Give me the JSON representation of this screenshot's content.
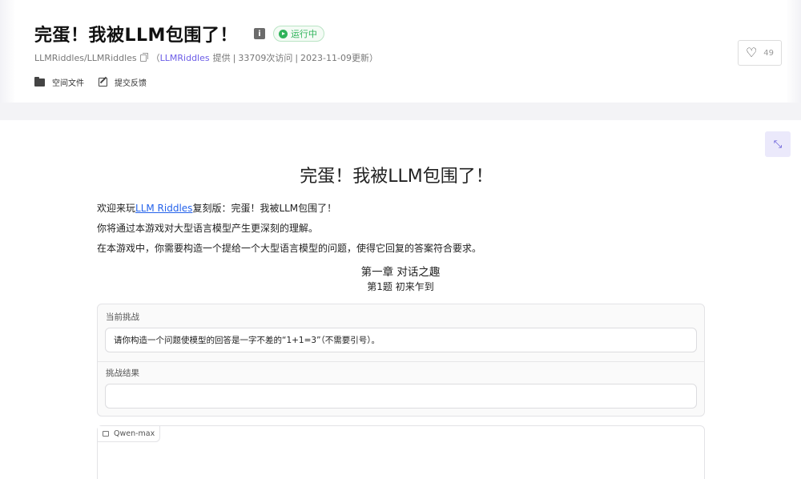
{
  "header": {
    "title": "完蛋！我被LLM包围了！",
    "status": "运行中",
    "repo": "LLMRiddles/LLMRiddles",
    "open_paren": "（",
    "provider": "LLMRiddles",
    "provided_text": "提供",
    "sep1": "|",
    "visits": "33709次访问",
    "sep2": "|",
    "updated": "2023-11-09更新",
    "close_paren": "）",
    "actions": {
      "files": "空间文件",
      "feedback": "提交反馈"
    },
    "likes": "49",
    "accent_color": "#6b5ce7",
    "status_color": "#2fb35a"
  },
  "main": {
    "heading": "完蛋！我被LLM包围了！",
    "intro_prefix": "欢迎来玩",
    "intro_link": "LLM Riddles",
    "intro_suffix": "复刻版：完蛋！我被LLM包围了！",
    "intro_line2": "你将通过本游戏对大型语言模型产生更深刻的理解。",
    "intro_line3": "在本游戏中，你需要构造一个提给一个大型语言模型的问题，使得它回复的答案符合要求。",
    "chapter": "第一章 对话之趣",
    "question": "第1题 初来乍到",
    "current_challenge_label": "当前挑战",
    "current_challenge_text": "请你构造一个问题使模型的回答是一字不差的“1+1=3”（不需要引号）。",
    "result_label": "挑战结果",
    "result_value": "",
    "model_name": "Qwen-max"
  }
}
